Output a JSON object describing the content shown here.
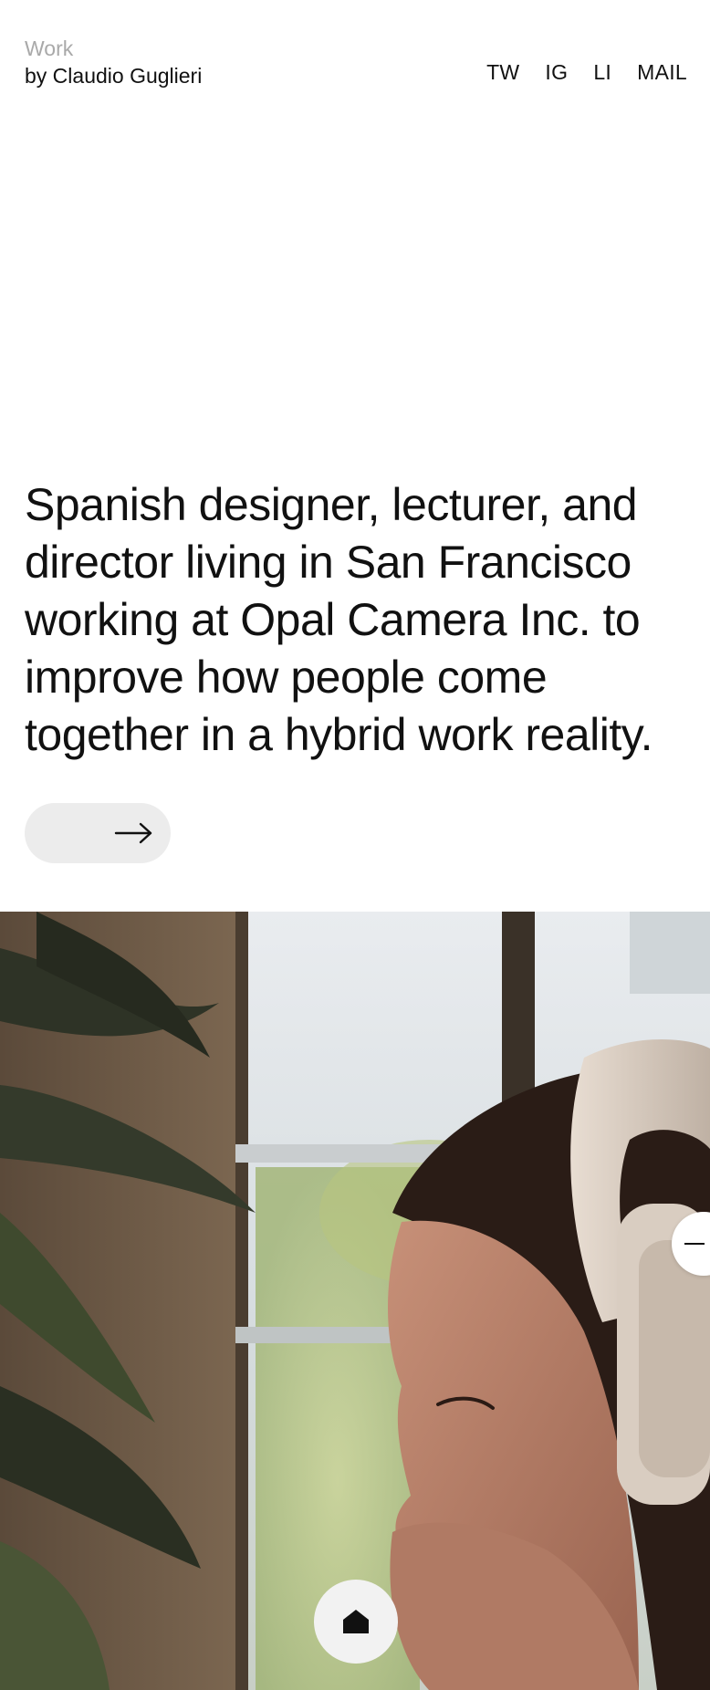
{
  "header": {
    "section_label": "Work",
    "author_line": "by Claudio Guglieri",
    "social": [
      {
        "label": "TW"
      },
      {
        "label": "IG"
      },
      {
        "label": "LI"
      },
      {
        "label": "MAIL"
      }
    ]
  },
  "intro": {
    "text": "Spanish designer, lecturer, and director living in San Francisco working at Opal Camera Inc. to improve how people come together in a hybrid work reality."
  },
  "controls": {
    "next_icon": "arrow-right-icon",
    "home_icon": "home-icon",
    "handle_icon": "minus-icon"
  },
  "hero": {
    "subject": "woman-with-headphones-photo"
  },
  "colors": {
    "background": "#ffffff",
    "text": "#111111",
    "muted": "#a9a9a9",
    "pill": "#ececec"
  }
}
